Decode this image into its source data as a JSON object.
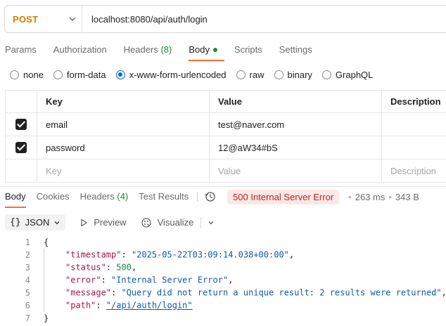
{
  "request": {
    "method": "POST",
    "url": "localhost:8080/api/auth/login"
  },
  "request_tabs": [
    {
      "label": "Params"
    },
    {
      "label": "Authorization"
    },
    {
      "label": "Headers",
      "count": "(8)"
    },
    {
      "label": "Body",
      "active": true
    },
    {
      "label": "Scripts"
    },
    {
      "label": "Settings"
    }
  ],
  "body_types": [
    "none",
    "form-data",
    "x-www-form-urlencoded",
    "raw",
    "binary",
    "GraphQL"
  ],
  "selected_body_type": "x-www-form-urlencoded",
  "params_table": {
    "headers": {
      "key": "Key",
      "value": "Value",
      "description": "Description"
    },
    "rows": [
      {
        "checked": true,
        "key": "email",
        "value": "test@naver.com",
        "description": ""
      },
      {
        "checked": true,
        "key": "password",
        "value": "12@aW34#bS",
        "description": ""
      }
    ],
    "placeholders": {
      "key": "Key",
      "value": "Value",
      "description": "Description"
    }
  },
  "response_tabs": [
    {
      "label": "Body",
      "active": true
    },
    {
      "label": "Cookies"
    },
    {
      "label": "Headers",
      "count": "(4)"
    },
    {
      "label": "Test Results"
    }
  ],
  "response_status": {
    "status": "500 Internal Server Error",
    "time": "263 ms",
    "size": "343 B",
    "status_color": "#b3261e"
  },
  "format_toolbar": {
    "format": "JSON",
    "preview": "Preview",
    "visualize": "Visualize"
  },
  "response_body": {
    "line_numbers": [
      "1",
      "2",
      "3",
      "4",
      "5",
      "6",
      "7"
    ],
    "open_brace": "{",
    "close_brace": "}",
    "fields": [
      {
        "key": "\"timestamp\"",
        "value": "\"2025-05-22T03:09:14.038+00:00\"",
        "type": "string",
        "trail": ","
      },
      {
        "key": "\"status\"",
        "value": "500",
        "type": "number",
        "trail": ","
      },
      {
        "key": "\"error\"",
        "value": "\"Internal Server Error\"",
        "type": "string",
        "trail": ","
      },
      {
        "key": "\"message\"",
        "value": "\"Query did not return a unique result: 2 results were returned\"",
        "type": "string",
        "trail": ","
      },
      {
        "key": "\"path\"",
        "value": "\"/api/auth/login\"",
        "type": "link",
        "trail": ""
      }
    ]
  },
  "colors": {
    "accent": "#ff6c37",
    "method": "#d97a00",
    "radio_selected": "#0265d2",
    "success_dot": "#1e8a3c"
  }
}
